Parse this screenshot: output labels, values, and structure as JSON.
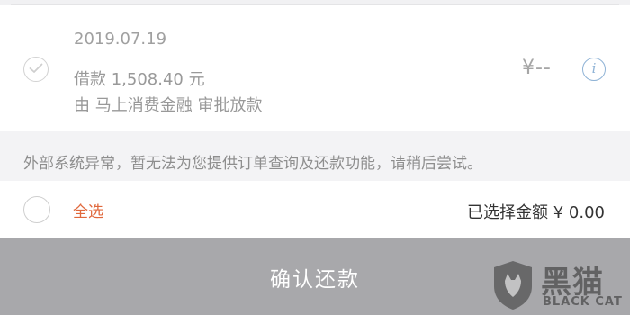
{
  "loan": {
    "date": "2019.07.19",
    "amount_text": "借款 1,508.40 元",
    "source_text": "由 马上消费金融 审批放款",
    "price_text": "¥--",
    "info_icon_glyph": "i",
    "check_icon": "checkmark-icon"
  },
  "notice": {
    "text": "外部系统异常，暂无法为您提供订单查询及还款功能，请稍后尝试。"
  },
  "selection": {
    "select_all_label": "全选",
    "summary_text": "已选择金额 ¥ 0.00"
  },
  "footer": {
    "confirm_label": "确认还款"
  },
  "watermark": {
    "cn_text": "黑猫",
    "en_text": "BLACK CAT"
  },
  "colors": {
    "accent_orange": "#e0683c",
    "button_disabled": "#a8a8ab",
    "info_blue": "#8fb3d6"
  }
}
